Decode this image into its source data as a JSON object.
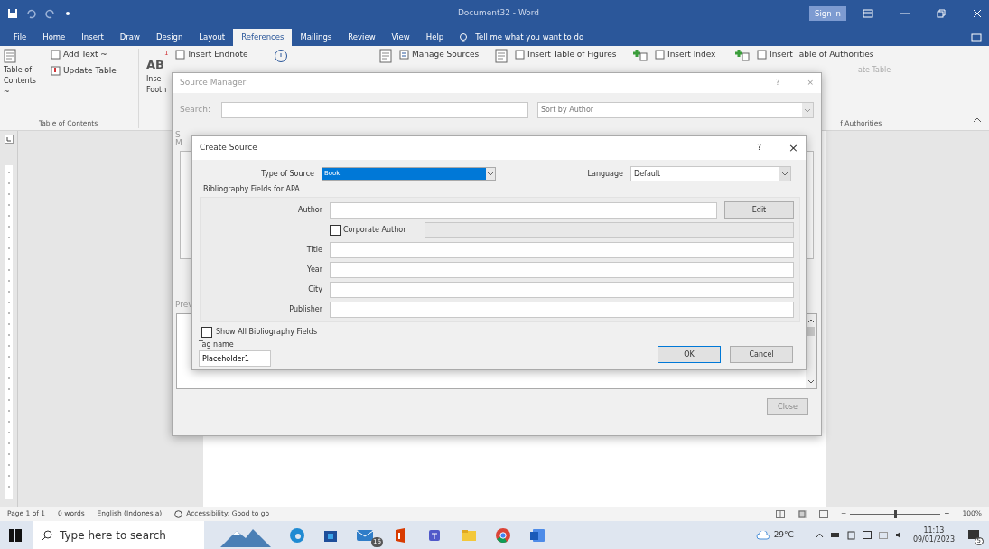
{
  "window": {
    "title": "Document32 - Word",
    "sign_in": "Sign in"
  },
  "tabs": [
    {
      "label": "File",
      "selected": false
    },
    {
      "label": "Home",
      "selected": false
    },
    {
      "label": "Insert",
      "selected": false
    },
    {
      "label": "Draw",
      "selected": false
    },
    {
      "label": "Design",
      "selected": false
    },
    {
      "label": "Layout",
      "selected": false
    },
    {
      "label": "References",
      "selected": true
    },
    {
      "label": "Mailings",
      "selected": false
    },
    {
      "label": "Review",
      "selected": false
    },
    {
      "label": "View",
      "selected": false
    },
    {
      "label": "Help",
      "selected": false
    }
  ],
  "tell_me": "Tell me what you want to do",
  "ribbon": {
    "toc_button": "Table of Contents ~",
    "add_text": "Add Text ~",
    "update_table": "Update Table",
    "toc_group": "Table of Contents",
    "footnote_big": "AB",
    "footnote_sup": "1",
    "insert_endnote": "Insert Endnote",
    "insert_cut": "Inse",
    "footnote_cut": "Footn",
    "manage_sources": "Manage Sources",
    "insert_table_of_figures": "Insert Table of Figures",
    "insert_index": "Insert Index",
    "insert_table_of_authorities": "Insert Table of Authorities",
    "update_table_cut": "ate Table",
    "authorities_group_cut": "f Authorities"
  },
  "source_manager": {
    "title": "Source Manager",
    "help": "?",
    "close_glyph": "×",
    "search_label": "Search:",
    "sort": "Sort by Author",
    "list_label_cut_1": "S",
    "list_label_cut_2": "M",
    "preview_cut": "Prev",
    "close_button": "Close"
  },
  "create_source": {
    "title": "Create Source",
    "help": "?",
    "close_glyph": "×",
    "type_label": "Type of Source",
    "type_value": "Book",
    "language_label": "Language",
    "language_value": "Default",
    "fields_heading": "Bibliography Fields for APA",
    "fields": [
      {
        "kind": "text_with_button",
        "label": "Author",
        "button": "Edit"
      },
      {
        "kind": "checkbox_field",
        "label": "Corporate Author",
        "checked": false
      },
      {
        "kind": "text",
        "label": "Title"
      },
      {
        "kind": "text",
        "label": "Year"
      },
      {
        "kind": "text",
        "label": "City"
      },
      {
        "kind": "text",
        "label": "Publisher"
      }
    ],
    "show_all": {
      "label": "Show All Bibliography Fields",
      "checked": false
    },
    "tag_label": "Tag name",
    "tag_value": "Placeholder1",
    "ok": "OK",
    "cancel": "Cancel"
  },
  "status_bar": {
    "page": "Page 1 of 1",
    "words": "0 words",
    "language": "English (Indonesia)",
    "accessibility": "Accessibility: Good to go",
    "zoom_out": "−",
    "zoom_slider": {
      "level": 0.5
    },
    "zoom_in": "+",
    "zoom": "100%"
  },
  "taskbar": {
    "search_placeholder": "Type here to search",
    "mail_badge": "16",
    "weather": "29°C",
    "time": "11:13",
    "date": "09/01/2023",
    "notification_count": "5"
  }
}
